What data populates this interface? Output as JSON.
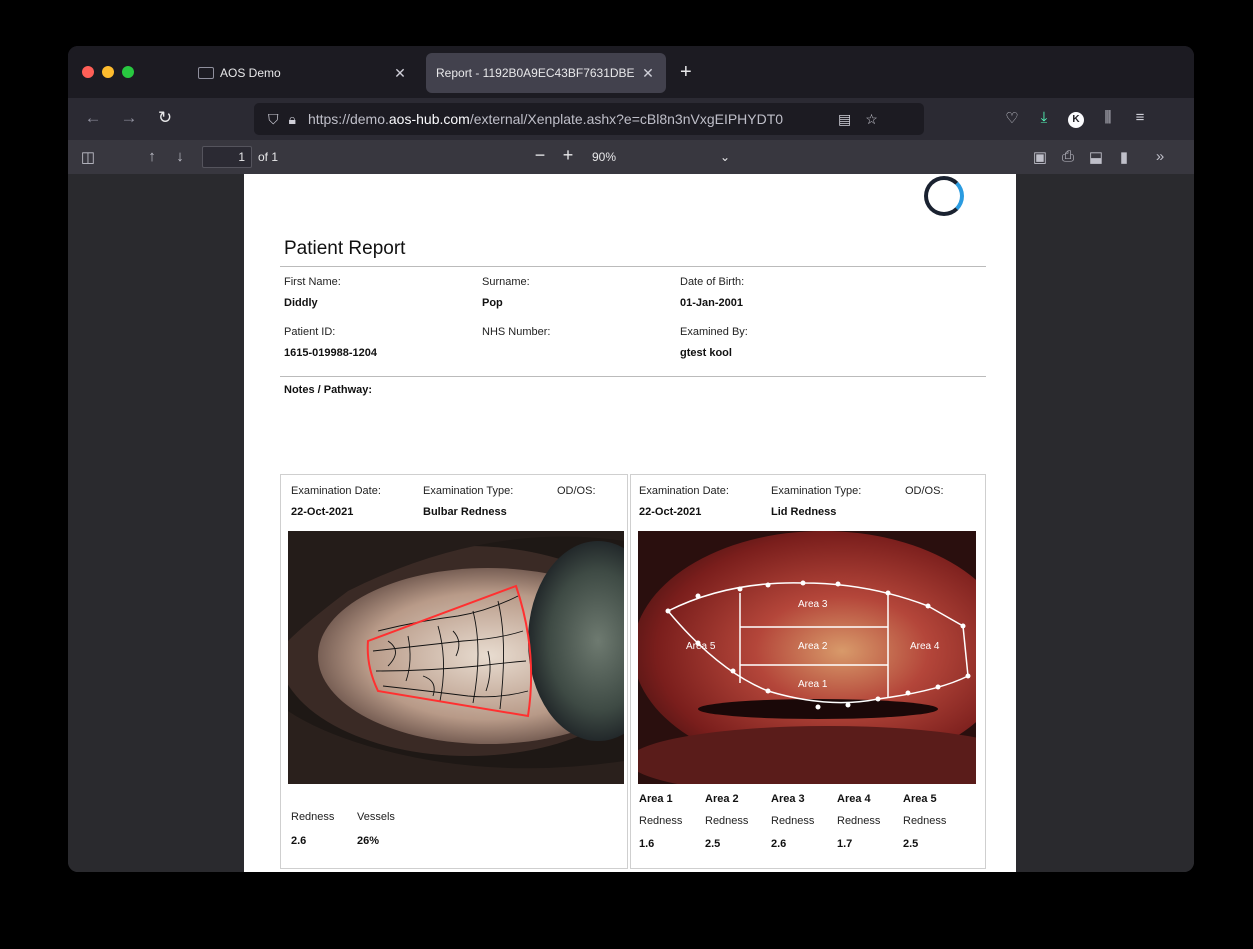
{
  "browser": {
    "tabs": [
      {
        "title": "AOS Demo",
        "active": false
      },
      {
        "title": "Report - 1192B0A9EC43BF7631DBE",
        "active": true
      }
    ],
    "url": {
      "prefix": "https://demo.",
      "domain": "aos-hub.com",
      "path": "/external/Xenplate.ashx?e=cBl8n3nVxgEIPHYDT0"
    },
    "avatar_letter": "K"
  },
  "pdf_toolbar": {
    "page_number": "1",
    "page_count": "of 1",
    "zoom": "90%"
  },
  "report": {
    "title": "Patient Report",
    "fields": {
      "first_name_label": "First Name:",
      "first_name": "Diddly",
      "surname_label": "Surname:",
      "surname": "Pop",
      "dob_label": "Date of Birth:",
      "dob": "01-Jan-2001",
      "patient_id_label": "Patient ID:",
      "patient_id": "1615-019988-1204",
      "nhs_label": "NHS Number:",
      "examined_by_label": "Examined By:",
      "examined_by": "gtest kool"
    },
    "notes_label": "Notes / Pathway:",
    "panel1": {
      "exam_date_label": "Examination Date:",
      "exam_date": "22-Oct-2021",
      "exam_type_label": "Examination Type:",
      "exam_type": "Bulbar Redness",
      "odos_label": "OD/OS:",
      "metrics": [
        {
          "label": "Redness",
          "value": "2.6"
        },
        {
          "label": "Vessels",
          "value": "26%"
        }
      ]
    },
    "panel2": {
      "exam_date_label": "Examination Date:",
      "exam_date": "22-Oct-2021",
      "exam_type_label": "Examination Type:",
      "exam_type": "Lid Redness",
      "odos_label": "OD/OS:",
      "image_area_labels": [
        "Area 3",
        "Area 2",
        "Area 1",
        "Area 5",
        "Area 4"
      ],
      "areas": [
        {
          "name": "Area 1",
          "label": "Redness",
          "value": "1.6"
        },
        {
          "name": "Area 2",
          "label": "Redness",
          "value": "2.5"
        },
        {
          "name": "Area 3",
          "label": "Redness",
          "value": "2.6"
        },
        {
          "name": "Area 4",
          "label": "Redness",
          "value": "1.7"
        },
        {
          "name": "Area 5",
          "label": "Redness",
          "value": "2.5"
        }
      ]
    }
  },
  "colors": {
    "red": "#ff5f57",
    "yellow": "#febc2e",
    "green": "#28c840",
    "accent": "#2a9be0",
    "download": "#54ffbd"
  }
}
